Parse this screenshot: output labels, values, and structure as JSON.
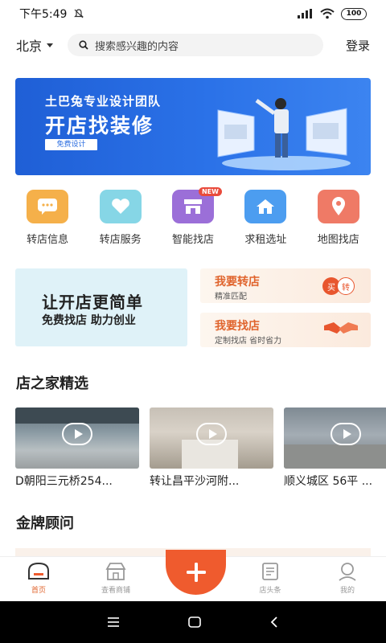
{
  "status": {
    "time": "下午5:49",
    "battery": "100"
  },
  "header": {
    "city": "北京",
    "search_placeholder": "搜索感兴趣的内容",
    "login": "登录"
  },
  "banner": {
    "line1": "土巴兔专业设计团队",
    "line2": "开店找装修",
    "button": "免费设计"
  },
  "grid": [
    {
      "label": "转店信息",
      "icon": "chat-bubble-icon",
      "color": "#f5b04a"
    },
    {
      "label": "转店服务",
      "icon": "heart-icon",
      "color": "#7fd4e4"
    },
    {
      "label": "智能找店",
      "icon": "shop-icon",
      "color": "#9b6fd8",
      "badge": "NEW"
    },
    {
      "label": "求租选址",
      "icon": "home-icon",
      "color": "#4c9df0"
    },
    {
      "label": "地图找店",
      "icon": "map-pin-icon",
      "color": "#ef6b58"
    }
  ],
  "promo": {
    "left_title": "让开店更简单",
    "left_sub": "免费找店  助力创业",
    "transfer_title": "我要转店",
    "transfer_sub": "精准匹配",
    "transfer_badge_buy": "买",
    "transfer_badge_sell": "转",
    "find_title": "我要找店",
    "find_sub": "定制找店 省时省力"
  },
  "sections": {
    "featured": "店之家精选",
    "advisors": "金牌顾问"
  },
  "videos": [
    {
      "title": "D朝阳三元桥254..."
    },
    {
      "title": "转让昌平沙河附..."
    },
    {
      "title": "顺义城区 56平 ..."
    }
  ],
  "tabs": [
    {
      "label": "首页",
      "icon": "home-tab-icon",
      "active": true
    },
    {
      "label": "查看商铺",
      "icon": "storefront-icon"
    },
    {
      "label": "店头条",
      "icon": "news-icon"
    },
    {
      "label": "我的",
      "icon": "profile-icon"
    }
  ],
  "colors": {
    "accent": "#ef5b2e",
    "banner": "#2b6fe6"
  }
}
